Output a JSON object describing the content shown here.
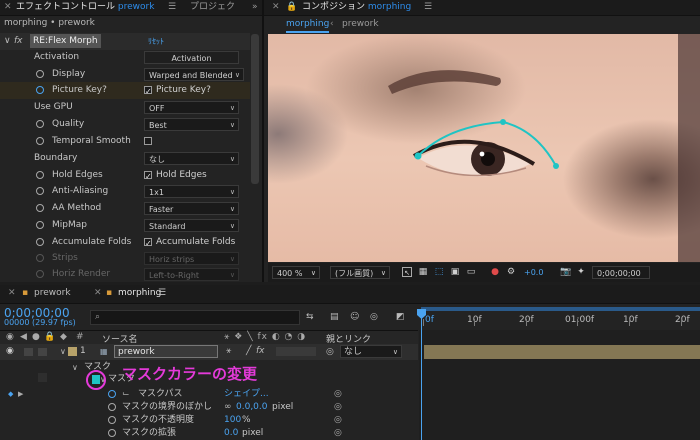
{
  "effect_panel": {
    "tab_title": "エフェクトコントロール",
    "tab_target": "prework",
    "tab_menu_icon": "hamburger-icon",
    "tab_project": "プロジェク",
    "breadcrumb": "morphing • prework",
    "effect_name": "RE:Flex Morph",
    "reset_label": "ﾘｾｯﾄ",
    "rows": [
      {
        "label": "Activation",
        "control": "Activation"
      },
      {
        "label": "Display",
        "control": "Warped and Blended"
      },
      {
        "label": "Picture Key?",
        "control": "Picture Key?"
      },
      {
        "label": "Use GPU",
        "control": "OFF"
      },
      {
        "label": "Quality",
        "control": "Best"
      },
      {
        "label": "Temporal Smooth",
        "control": ""
      },
      {
        "label": "Boundary",
        "control": "なし"
      },
      {
        "label": "Hold Edges",
        "control": "Hold Edges"
      },
      {
        "label": "Anti-Aliasing",
        "control": "1x1"
      },
      {
        "label": "AA Method",
        "control": "Faster"
      },
      {
        "label": "MipMap",
        "control": "Standard"
      },
      {
        "label": "Accumulate Folds",
        "control": "Accumulate Folds"
      },
      {
        "label": "Strips",
        "control": "Horiz strips"
      },
      {
        "label": "Horiz Render",
        "control": "Left-to-Right"
      }
    ]
  },
  "comp_panel": {
    "tab_title": "コンポジション",
    "tab_target": "morphing",
    "subtab_active": "morphing",
    "subtab_other": "prework",
    "zoom": "400 %",
    "resolution": "(フル画質)",
    "exposure": "+0.0",
    "timecode": "0;00;00;00",
    "mask_color": "#1fc4c4"
  },
  "timeline": {
    "tab1": "prework",
    "tab2": "morphing",
    "timecode": "0;00;00;00",
    "timecode_sub": "00000 (29.97 fps)",
    "col_source": "ソース名",
    "col_parent": "親とリンク",
    "layer_number": "1",
    "layer_name": "prework",
    "layer_parent": "なし",
    "mask_group": "マスク",
    "mask_name": "マスク",
    "mask_path_label": "マスクパス",
    "mask_path_value": "シェイプ...",
    "mask_feather_label": "マスクの境界のぼかし",
    "mask_feather_value": "0.0,0.0",
    "mask_feather_unit": "pixel",
    "mask_opacity_label": "マスクの不透明度",
    "mask_opacity_value": "100",
    "mask_opacity_unit": "%",
    "mask_expansion_label": "マスクの拡張",
    "mask_expansion_value": "0.0",
    "mask_expansion_unit": "pixel",
    "annotation": "マスクカラーの変更",
    "ruler": [
      "0f",
      "10f",
      "20f",
      "01:00f",
      "10f",
      "20f"
    ]
  }
}
